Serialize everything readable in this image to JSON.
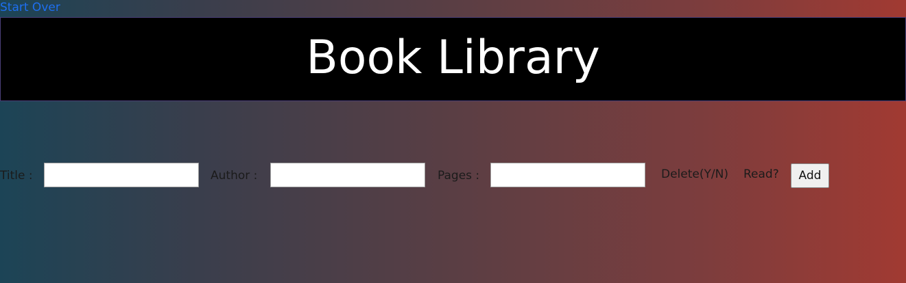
{
  "nav": {
    "start_over_label": "Start Over"
  },
  "header": {
    "title": "Book Library"
  },
  "form": {
    "title_label": "Title :",
    "title_value": "",
    "author_label": "Author :",
    "author_value": "",
    "pages_label": "Pages :",
    "pages_value": "",
    "delete_label": "Delete(Y/N)",
    "read_label": "Read?",
    "add_button_label": "Add"
  },
  "colors": {
    "link": "#1e6ff0",
    "banner_background": "#000000",
    "banner_text": "#ffffff",
    "gradient_left": "#1c4456",
    "gradient_right": "#a13a32"
  }
}
